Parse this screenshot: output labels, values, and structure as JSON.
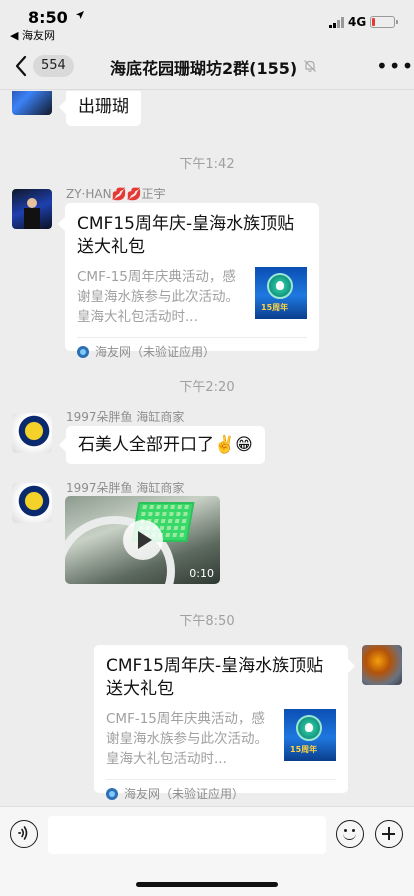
{
  "status_bar": {
    "time": "8:50",
    "back_app": "◀ 海友网",
    "network": "4G",
    "battery_level": 0.15,
    "battery_color": "#e53935"
  },
  "nav": {
    "unread_count": "554",
    "title": "海底花园珊瑚坊2群(155)",
    "back_icon": "chevron-left-icon",
    "mute_icon": "bell-off-icon",
    "more_icon": "ellipsis-icon"
  },
  "messages": {
    "m0": {
      "text": "出珊瑚"
    },
    "ts1": "下午1:42",
    "m1": {
      "sender": "ZY·HAN💋💋正宇",
      "title": "CMF15周年庆-皇海水族顶贴送大礼包",
      "desc": "CMF-15周年庆典活动，感谢皇海水族参与此次活动。皇海大礼包活动时...",
      "thumb_tag": "15周年",
      "source": "海友网（未验证应用）"
    },
    "ts2": "下午2:20",
    "m2": {
      "sender": "1997朵胖鱼 海缸商家",
      "text": "石美人全部开口了✌️😁"
    },
    "m3": {
      "sender": "1997朵胖鱼 海缸商家",
      "duration": "0:10"
    },
    "ts3": "下午8:50",
    "m4": {
      "title": "CMF15周年庆-皇海水族顶贴送大礼包",
      "desc": "CMF-15周年庆典活动，感谢皇海水族参与此次活动。皇海大礼包活动时...",
      "thumb_tag": "15周年",
      "source": "海友网（未验证应用）"
    }
  },
  "input_bar": {
    "voice_icon": "voice-icon",
    "input_value": "",
    "emoji_icon": "emoji-icon",
    "plus_icon": "plus-icon"
  }
}
